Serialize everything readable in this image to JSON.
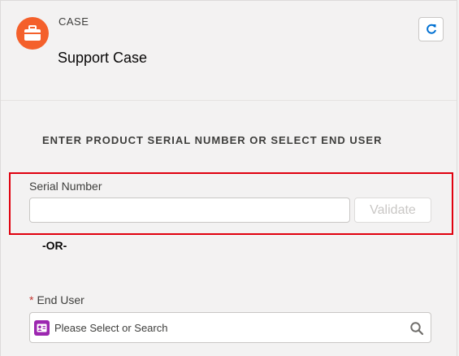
{
  "header": {
    "object_label": "CASE",
    "title": "Support Case",
    "icon": "briefcase-icon",
    "refresh_icon": "refresh-icon",
    "accent_color": "#f4602b"
  },
  "form": {
    "section_heading": "ENTER PRODUCT SERIAL NUMBER OR SELECT END USER",
    "serial_number": {
      "label": "Serial Number",
      "value": "",
      "validate_label": "Validate"
    },
    "or_text": "-OR-",
    "end_user": {
      "required_marker": "*",
      "label": "End User",
      "placeholder": "Please Select or Search",
      "icon": "contact-icon",
      "search_icon": "search-icon"
    }
  },
  "colors": {
    "highlight_border": "#e0000e",
    "required": "#c23934",
    "contact_icon_bg": "#9c27b0"
  }
}
